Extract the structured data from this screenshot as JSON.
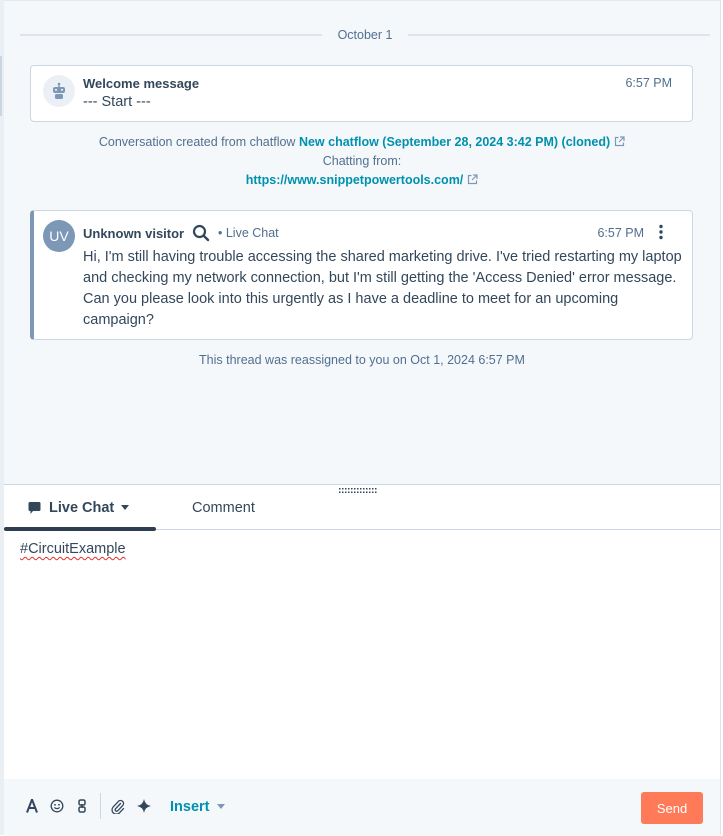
{
  "thread": {
    "date_separator": "October 1",
    "welcome": {
      "title": "Welcome message",
      "body": "--- Start ---",
      "time": "6:57 PM",
      "avatar_icon": "robot-icon"
    },
    "conversation_meta": {
      "prefix": "Conversation created from chatflow",
      "chatflow_link": "New chatflow (September 28, 2024 3:42 PM) (cloned)",
      "chatting_from_label": "Chatting from:",
      "url_link": "https://www.snippetpowertools.com/"
    },
    "visitor_message": {
      "avatar_initials": "UV",
      "sender": "Unknown visitor",
      "channel": "• Live Chat",
      "time": "6:57 PM",
      "text": "Hi, I'm still having trouble accessing the shared marketing drive. I've tried restarting my laptop and checking my network connection, but I'm still getting the 'Access Denied' error message. Can you please look into this urgently as I have a deadline to meet for an upcoming campaign?"
    },
    "reassign_note": "This thread was reassigned to you on Oct 1, 2024 6:57 PM"
  },
  "composer": {
    "tabs": [
      {
        "label": "Live Chat",
        "active": true,
        "icon": "chat-bubble-icon"
      },
      {
        "label": "Comment",
        "active": false
      }
    ],
    "editor_text": "#CircuitExample",
    "toolbar": {
      "icons": [
        "text-format-icon",
        "emoji-icon",
        "snippet-icon",
        "attachment-icon",
        "ai-sparkle-icon"
      ],
      "insert_label": "Insert",
      "send_label": "Send"
    }
  },
  "colors": {
    "accent_link": "#0091ae",
    "send_button": "#ff7a59",
    "text_primary": "#33475b",
    "text_secondary": "#516f90"
  }
}
